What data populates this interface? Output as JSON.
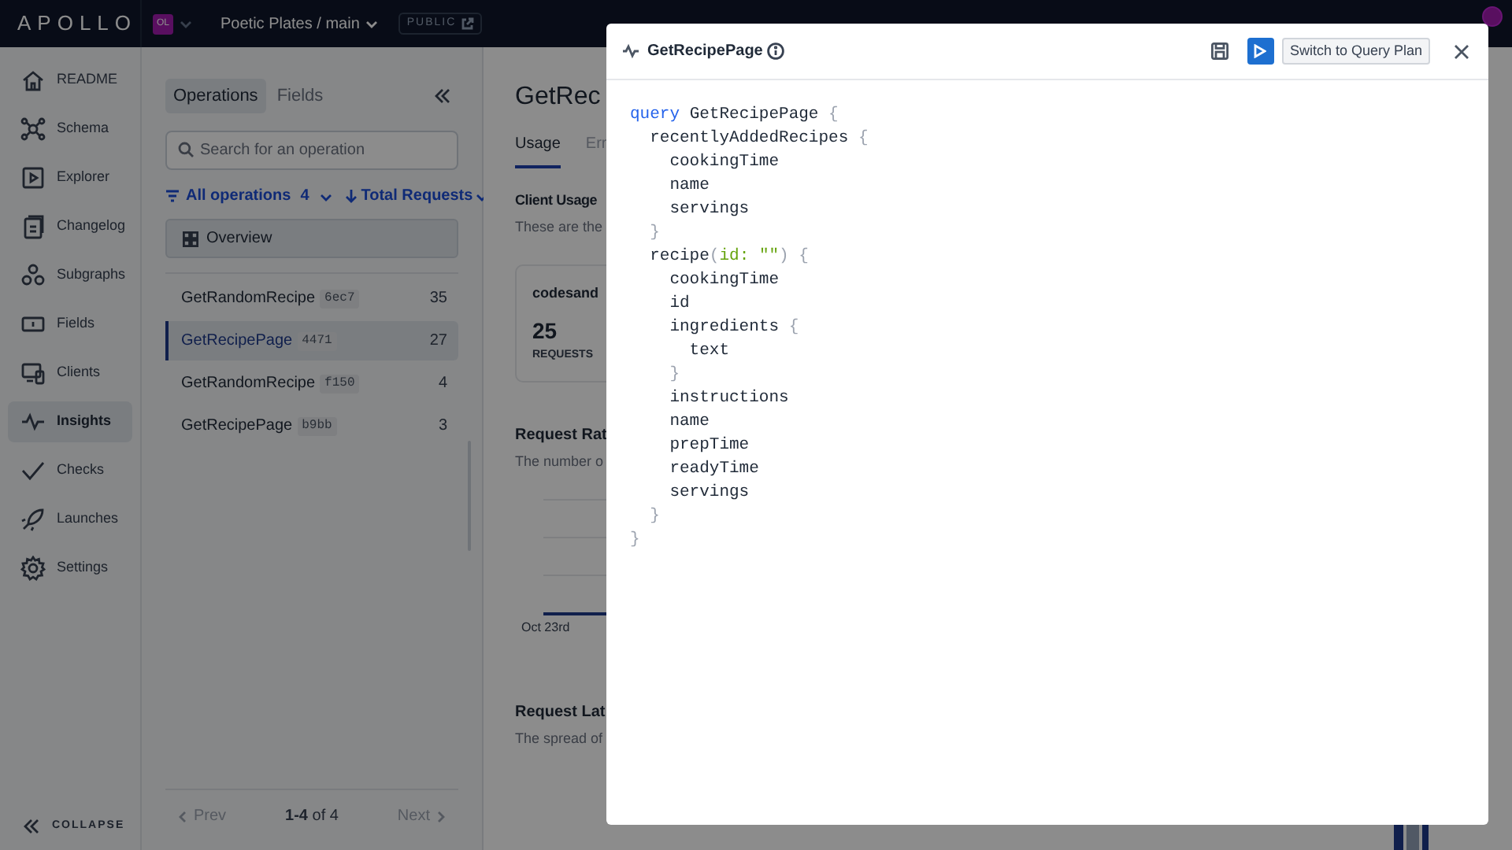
{
  "topbar": {
    "logo": "APOLLO",
    "org_badge": "OL",
    "graph": "Poetic Plates / main",
    "visibility": "PUBLIC"
  },
  "sidebar": {
    "items": [
      {
        "label": "README",
        "selected": false
      },
      {
        "label": "Schema",
        "selected": false
      },
      {
        "label": "Explorer",
        "selected": false
      },
      {
        "label": "Changelog",
        "selected": false
      },
      {
        "label": "Subgraphs",
        "selected": false
      },
      {
        "label": "Fields",
        "selected": false
      },
      {
        "label": "Clients",
        "selected": false
      },
      {
        "label": "Insights",
        "selected": true
      },
      {
        "label": "Checks",
        "selected": false
      },
      {
        "label": "Launches",
        "selected": false
      },
      {
        "label": "Settings",
        "selected": false
      }
    ],
    "collapse": "COLLAPSE"
  },
  "operations_panel": {
    "tabs": [
      {
        "label": "Operations",
        "selected": true
      },
      {
        "label": "Fields",
        "selected": false
      }
    ],
    "search": {
      "placeholder": "Search for an operation"
    },
    "filter": {
      "label": "All operations",
      "count": "4"
    },
    "sort": {
      "label": "Total Requests"
    },
    "overview": "Overview",
    "rows": [
      {
        "name": "GetRandomRecipe",
        "hash": "6ec7",
        "count": "35",
        "selected": false
      },
      {
        "name": "GetRecipePage",
        "hash": "4471",
        "count": "27",
        "selected": true
      },
      {
        "name": "GetRandomRecipe",
        "hash": "f150",
        "count": "4",
        "selected": false
      },
      {
        "name": "GetRecipePage",
        "hash": "b9bb",
        "count": "3",
        "selected": false
      }
    ],
    "pagination": {
      "prev": "Prev",
      "range": "**1-4** of 4",
      "next": "Next"
    }
  },
  "main": {
    "title": "GetRec",
    "tabs": [
      {
        "label": "Usage",
        "selected": true
      },
      {
        "label": "Err",
        "selected": false
      }
    ],
    "client_usage": {
      "heading": "Client Usage",
      "description": "These are the"
    },
    "client_card": {
      "name": "codesand",
      "requests": "25",
      "requests_label": "REQUESTS"
    },
    "request_rate": {
      "heading": "Request Rat",
      "description": "The number o",
      "x_label": "Oct 23rd"
    },
    "request_latency": {
      "heading": "Request Lat",
      "description": "The spread of"
    }
  },
  "modal": {
    "title": "GetRecipePage",
    "button": "Switch to Query Plan",
    "code": [
      [
        {
          "kind": "keyword",
          "text": "query"
        },
        {
          "kind": "name",
          "text": " GetRecipePage "
        },
        {
          "kind": "punct",
          "text": "{"
        }
      ],
      [
        {
          "kind": "name",
          "text": "  recentlyAddedRecipes "
        },
        {
          "kind": "punct",
          "text": "{"
        }
      ],
      [
        {
          "kind": "name",
          "text": "    cookingTime"
        }
      ],
      [
        {
          "kind": "name",
          "text": "    name"
        }
      ],
      [
        {
          "kind": "name",
          "text": "    servings"
        }
      ],
      [
        {
          "kind": "punct",
          "text": "  }"
        }
      ],
      [
        {
          "kind": "name",
          "text": "  recipe"
        },
        {
          "kind": "punct",
          "text": "("
        },
        {
          "kind": "arg",
          "text": "id: \"\""
        },
        {
          "kind": "punct",
          "text": ") {"
        }
      ],
      [
        {
          "kind": "name",
          "text": "    cookingTime"
        }
      ],
      [
        {
          "kind": "name",
          "text": "    id"
        }
      ],
      [
        {
          "kind": "name",
          "text": "    ingredients "
        },
        {
          "kind": "punct",
          "text": "{"
        }
      ],
      [
        {
          "kind": "name",
          "text": "      text"
        }
      ],
      [
        {
          "kind": "punct",
          "text": "    }"
        }
      ],
      [
        {
          "kind": "name",
          "text": "    instructions"
        }
      ],
      [
        {
          "kind": "name",
          "text": "    name"
        }
      ],
      [
        {
          "kind": "name",
          "text": "    prepTime"
        }
      ],
      [
        {
          "kind": "name",
          "text": "    readyTime"
        }
      ],
      [
        {
          "kind": "name",
          "text": "    servings"
        }
      ],
      [
        {
          "kind": "punct",
          "text": "  }"
        }
      ],
      [
        {
          "kind": "punct",
          "text": "}"
        }
      ]
    ]
  }
}
